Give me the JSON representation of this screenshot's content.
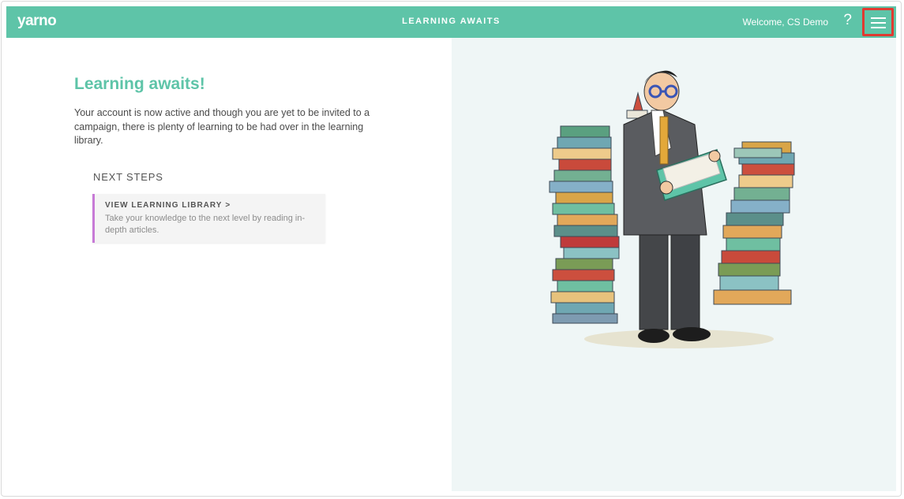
{
  "header": {
    "logo": "yarno",
    "title": "LEARNING AWAITS",
    "welcome": "Welcome, CS Demo",
    "help_label": "?",
    "menu_icon": "hamburger-menu-icon",
    "accent_color": "#5ec4a8"
  },
  "main": {
    "heading": "Learning awaits!",
    "intro": "Your account is now active and though you are yet to be invited to a campaign, there is plenty of learning to be had over in the learning library.",
    "next_steps_label": "NEXT STEPS",
    "card": {
      "title": "VIEW LEARNING LIBRARY",
      "chevron": ">",
      "description": "Take your knowledge to the next level by reading in-depth articles."
    }
  },
  "illustration": {
    "icon": "man-reading-book-with-book-stacks-illustration"
  }
}
